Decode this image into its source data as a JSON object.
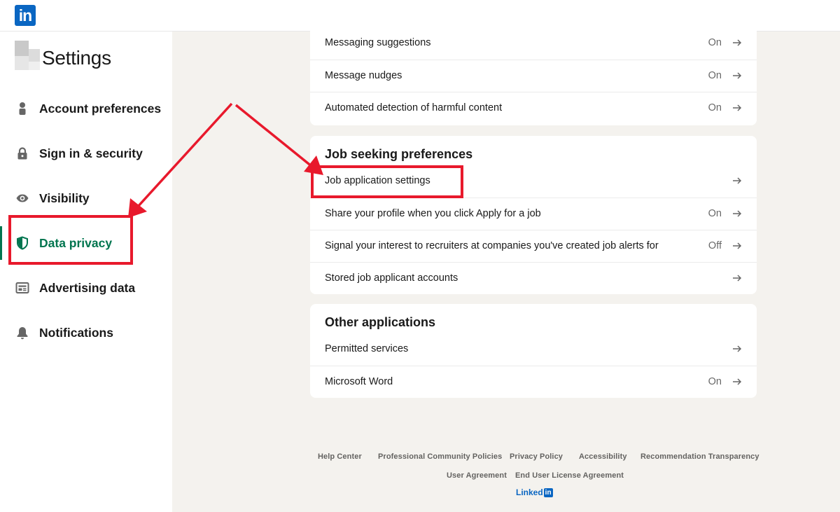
{
  "header": {
    "logo_text": "in"
  },
  "sidebar": {
    "title": "Settings",
    "items": [
      {
        "label": "Account preferences",
        "icon": "person-icon"
      },
      {
        "label": "Sign in & security",
        "icon": "lock-icon"
      },
      {
        "label": "Visibility",
        "icon": "eye-icon"
      },
      {
        "label": "Data privacy",
        "icon": "shield-icon",
        "active": true
      },
      {
        "label": "Advertising data",
        "icon": "newspaper-icon"
      },
      {
        "label": "Notifications",
        "icon": "bell-icon"
      }
    ]
  },
  "messaging_card": {
    "rows": [
      {
        "label": "Messaging suggestions",
        "value": "On"
      },
      {
        "label": "Message nudges",
        "value": "On"
      },
      {
        "label": "Automated detection of harmful content",
        "value": "On"
      }
    ]
  },
  "job_card": {
    "title": "Job seeking preferences",
    "rows": [
      {
        "label": "Job application settings",
        "value": ""
      },
      {
        "label": "Share your profile when you click Apply for a job",
        "value": "On"
      },
      {
        "label": "Signal your interest to recruiters at companies you've created job alerts for",
        "value": "Off"
      },
      {
        "label": "Stored job applicant accounts",
        "value": ""
      }
    ]
  },
  "other_card": {
    "title": "Other applications",
    "rows": [
      {
        "label": "Permitted services",
        "value": ""
      },
      {
        "label": "Microsoft Word",
        "value": "On"
      }
    ]
  },
  "footer": {
    "links": [
      "Help Center",
      "Professional Community Policies",
      "Privacy Policy",
      "Accessibility",
      "Recommendation Transparency",
      "User Agreement",
      "End User License Agreement"
    ],
    "brand_text": "Linked",
    "brand_box": "in"
  },
  "colors": {
    "accent_green": "#01754f",
    "linkedin_blue": "#0a66c2",
    "annotation_red": "#e8192c",
    "background": "#f4f2ee"
  }
}
